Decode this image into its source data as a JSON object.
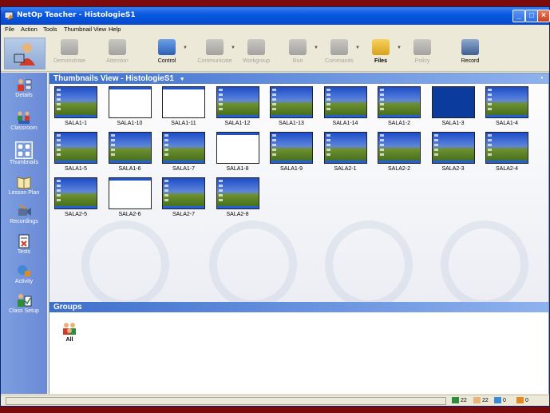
{
  "window": {
    "title": "NetOp Teacher - HistologieS1"
  },
  "menu": [
    "File",
    "Action",
    "Tools",
    "Thumbnail View",
    "Help"
  ],
  "toolbar": {
    "items": [
      {
        "label": "Demonstrate",
        "enabled": false
      },
      {
        "label": "Attention",
        "enabled": false
      },
      {
        "label": "Control",
        "enabled": true
      },
      {
        "label": "Communicate",
        "enabled": false
      },
      {
        "label": "Workgroup",
        "enabled": false
      },
      {
        "label": "Run",
        "enabled": false
      },
      {
        "label": "Commands",
        "enabled": false
      },
      {
        "label": "Files",
        "enabled": true
      },
      {
        "label": "Policy",
        "enabled": false
      },
      {
        "label": "Record",
        "enabled": true
      }
    ]
  },
  "sidebar": {
    "items": [
      {
        "label": "Details",
        "icon": "details-icon"
      },
      {
        "label": "Classroom",
        "icon": "classroom-icon"
      },
      {
        "label": "Thumbnails",
        "icon": "thumbnails-icon",
        "active": true
      },
      {
        "label": "Lesson Plan",
        "icon": "lesson-plan-icon"
      },
      {
        "label": "Recordings",
        "icon": "recordings-icon"
      },
      {
        "label": "Tests",
        "icon": "tests-icon"
      },
      {
        "label": "Activity",
        "icon": "activity-icon"
      },
      {
        "label": "Class Setup",
        "icon": "class-setup-icon"
      }
    ]
  },
  "thumbnails_view": {
    "header": "Thumbnails View - HistologieS1",
    "computers": [
      {
        "name": "SALA1-1",
        "screen": "desktop"
      },
      {
        "name": "SALA1-10",
        "screen": "blank"
      },
      {
        "name": "SALA1-11",
        "screen": "blank"
      },
      {
        "name": "SALA1-12",
        "screen": "desktop"
      },
      {
        "name": "SALA1-13",
        "screen": "desktop"
      },
      {
        "name": "SALA1-14",
        "screen": "desktop"
      },
      {
        "name": "SALA1-2",
        "screen": "desktop"
      },
      {
        "name": "SALA1-3",
        "screen": "blue"
      },
      {
        "name": "SALA1-4",
        "screen": "desktop"
      },
      {
        "name": "SALA1-5",
        "screen": "desktop"
      },
      {
        "name": "SALA1-6",
        "screen": "desktop"
      },
      {
        "name": "SALA1-7",
        "screen": "desktop"
      },
      {
        "name": "SALA1-8",
        "screen": "blank"
      },
      {
        "name": "SALA1-9",
        "screen": "desktop"
      },
      {
        "name": "SALA2-1",
        "screen": "desktop"
      },
      {
        "name": "SALA2-2",
        "screen": "desktop"
      },
      {
        "name": "SALA2-3",
        "screen": "desktop"
      },
      {
        "name": "SALA2-4",
        "screen": "desktop"
      },
      {
        "name": "SALA2-5",
        "screen": "desktop"
      },
      {
        "name": "SALA2-6",
        "screen": "blank"
      },
      {
        "name": "SALA2-7",
        "screen": "desktop"
      },
      {
        "name": "SALA2-8",
        "screen": "desktop"
      }
    ]
  },
  "groups": {
    "header": "Groups",
    "items": [
      {
        "name": "All"
      }
    ]
  },
  "status": {
    "connected": "22",
    "students": "22",
    "tests": "0",
    "activity": "0"
  },
  "colors": {
    "background": "#7a0a0c",
    "titlebar": "#0a5ae0",
    "sidebar": "#7d9ee0",
    "panel_header": "#3d6fcc"
  }
}
